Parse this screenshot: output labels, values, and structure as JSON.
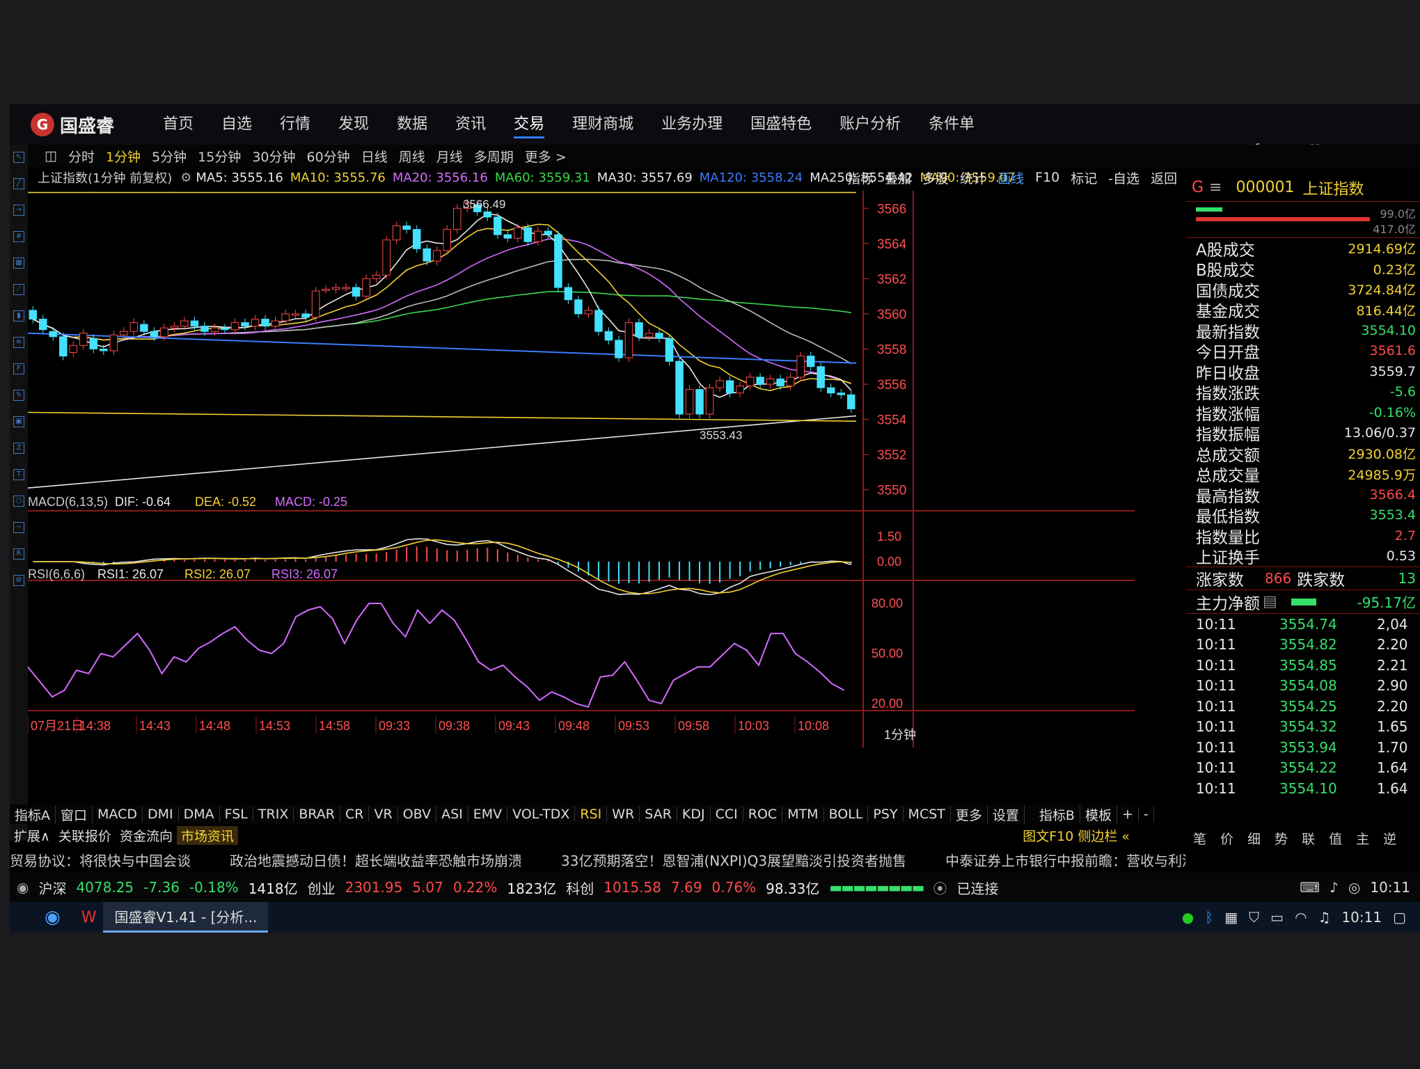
{
  "app": {
    "logo": "国盛睿",
    "nav": [
      "首页",
      "自选",
      "行情",
      "发现",
      "数据",
      "资讯",
      "交易",
      "理财商城",
      "业务办理",
      "国盛特色",
      "账户分析",
      "条件单"
    ],
    "active_nav": "交易"
  },
  "periods": [
    "分时",
    "1分钟",
    "5分钟",
    "15分钟",
    "30分钟",
    "60分钟",
    "日线",
    "周线",
    "月线",
    "多周期",
    "更多 >"
  ],
  "active_period": "1分钟",
  "main_header": {
    "title": "上证指数(1分钟 前复权)",
    "ma": [
      {
        "label": "MA5: 3555.16",
        "color": "#e8e8e8"
      },
      {
        "label": "MA10: 3555.76",
        "color": "#f2d133"
      },
      {
        "label": "MA20: 3556.16",
        "color": "#d36bff"
      },
      {
        "label": "MA60: 3559.31",
        "color": "#39d94a"
      },
      {
        "label": "MA30: 3557.69",
        "color": "#e8e8e8"
      },
      {
        "label": "MA120: 3558.24",
        "color": "#3a7dff"
      },
      {
        "label": "MA250: 3554.42",
        "color": "#e8e8e8"
      },
      {
        "label": "MA90: 3559.07",
        "color": "#f2d133"
      }
    ]
  },
  "tools": [
    "指标",
    "叠加",
    "多股",
    "统计",
    "画线",
    "F10",
    "标记",
    "-自选",
    "返回"
  ],
  "chart_data": {
    "type": "candlestick",
    "price_axis": {
      "ticks": [
        "3566",
        "3564",
        "3562",
        "3560",
        "3558",
        "3556",
        "3554",
        "3552",
        "3550"
      ],
      "range": [
        3549,
        3567
      ]
    },
    "high_label": "3566.49",
    "low_label": "3553.43",
    "candles": [
      [
        3560.2,
        3559.7
      ],
      [
        3559.7,
        3559.1
      ],
      [
        3559.0,
        3558.7
      ],
      [
        3558.7,
        3557.6
      ],
      [
        3557.8,
        3558.2
      ],
      [
        3558.2,
        3558.9
      ],
      [
        3558.6,
        3558.0
      ],
      [
        3558.0,
        3557.9
      ],
      [
        3557.9,
        3558.8
      ],
      [
        3558.8,
        3559.0
      ],
      [
        3559.0,
        3559.5
      ],
      [
        3559.4,
        3559.0
      ],
      [
        3559.0,
        3558.7
      ],
      [
        3558.7,
        3559.2
      ],
      [
        3559.2,
        3559.3
      ],
      [
        3559.3,
        3559.6
      ],
      [
        3559.6,
        3559.3
      ],
      [
        3559.3,
        3559.0
      ],
      [
        3559.0,
        3559.2
      ],
      [
        3559.2,
        3559.1
      ],
      [
        3559.1,
        3559.5
      ],
      [
        3559.5,
        3559.3
      ],
      [
        3559.3,
        3559.7
      ],
      [
        3559.7,
        3559.3
      ],
      [
        3559.3,
        3559.6
      ],
      [
        3559.6,
        3560.0
      ],
      [
        3560.0,
        3560.0
      ],
      [
        3560.0,
        3559.8
      ],
      [
        3559.8,
        3561.3
      ],
      [
        3561.4,
        3561.4
      ],
      [
        3561.4,
        3561.5
      ],
      [
        3561.5,
        3561.5
      ],
      [
        3561.5,
        3561.0
      ],
      [
        3561.0,
        3562.0
      ],
      [
        3562.0,
        3562.2
      ],
      [
        3562.2,
        3564.2
      ],
      [
        3564.2,
        3565.0
      ],
      [
        3565.0,
        3564.8
      ],
      [
        3564.8,
        3563.7
      ],
      [
        3563.7,
        3563.0
      ],
      [
        3563.0,
        3563.6
      ],
      [
        3563.6,
        3564.8
      ],
      [
        3564.8,
        3566.0
      ],
      [
        3566.0,
        3566.3
      ],
      [
        3566.2,
        3565.8
      ],
      [
        3565.8,
        3565.5
      ],
      [
        3565.5,
        3564.5
      ],
      [
        3564.5,
        3564.3
      ],
      [
        3564.3,
        3564.9
      ],
      [
        3564.9,
        3564.1
      ],
      [
        3564.1,
        3564.7
      ],
      [
        3564.7,
        3564.5
      ],
      [
        3564.5,
        3561.5
      ],
      [
        3561.5,
        3560.8
      ],
      [
        3560.8,
        3560.0
      ],
      [
        3560.0,
        3560.2
      ],
      [
        3560.2,
        3559.0
      ],
      [
        3559.0,
        3558.5
      ],
      [
        3558.5,
        3557.5
      ],
      [
        3557.5,
        3559.5
      ],
      [
        3559.5,
        3558.7
      ],
      [
        3558.7,
        3558.9
      ],
      [
        3558.9,
        3558.6
      ],
      [
        3558.6,
        3557.3
      ],
      [
        3557.3,
        3554.3
      ],
      [
        3554.3,
        3555.7
      ],
      [
        3555.7,
        3554.3
      ],
      [
        3554.3,
        3555.8
      ],
      [
        3555.8,
        3556.2
      ],
      [
        3556.2,
        3555.5
      ],
      [
        3555.5,
        3555.9
      ],
      [
        3555.9,
        3556.4
      ],
      [
        3556.4,
        3556.0
      ],
      [
        3556.0,
        3556.3
      ],
      [
        3556.3,
        3555.9
      ],
      [
        3555.9,
        3556.4
      ],
      [
        3556.4,
        3557.6
      ],
      [
        3557.6,
        3557.0
      ],
      [
        3557.0,
        3555.8
      ],
      [
        3555.8,
        3555.5
      ],
      [
        3555.5,
        3555.4
      ],
      [
        3555.4,
        3554.6
      ]
    ],
    "macd_header": {
      "label": "MACD(6,13,5)",
      "dif": "DIF: -0.64",
      "dea": "DEA: -0.52",
      "macd": "MACD: -0.25"
    },
    "macd_axis": [
      "1.50",
      "0.00"
    ],
    "rsi_header": {
      "label": "RSI(6,6,6)",
      "rsi1": "RSI1: 26.07",
      "rsi2": "RSI2: 26.07",
      "rsi3": "RSI3: 26.07"
    },
    "rsi_axis": [
      "80.00",
      "50.00",
      "20.00"
    ],
    "rsi_values": [
      42,
      33,
      24,
      28,
      40,
      38,
      50,
      48,
      55,
      62,
      52,
      38,
      48,
      45,
      53,
      57,
      62,
      66,
      58,
      52,
      50,
      56,
      72,
      76,
      78,
      71,
      56,
      70,
      80,
      80,
      68,
      60,
      76,
      68,
      76,
      70,
      58,
      45,
      40,
      43,
      36,
      30,
      22,
      27,
      24,
      20,
      18,
      36,
      37,
      45,
      34,
      22,
      20,
      34,
      38,
      42,
      42,
      49,
      56,
      52,
      43,
      62,
      62,
      50,
      45,
      39,
      32,
      28
    ],
    "time_labels": [
      "07月21日",
      "14:38",
      "14:43",
      "14:48",
      "14:53",
      "14:58",
      "09:33",
      "09:38",
      "09:43",
      "09:48",
      "09:53",
      "09:58",
      "10:03",
      "10:08"
    ],
    "period_tag": "1分钟"
  },
  "indicator_tabs": [
    "指标A",
    "窗口",
    "MACD",
    "DMI",
    "DMA",
    "FSL",
    "TRIX",
    "BRAR",
    "CR",
    "VR",
    "OBV",
    "ASI",
    "EMV",
    "VOL-TDX",
    "RSI",
    "WR",
    "SAR",
    "KDJ",
    "CCI",
    "ROC",
    "MTM",
    "BOLL",
    "PSY",
    "MCST",
    "更多",
    "设置"
  ],
  "indicator_active": "RSI",
  "indicator_tabs_right": [
    "指标B",
    "模板",
    "+",
    "-"
  ],
  "sub_tabs": [
    "扩展∧",
    "关联报价",
    "资金流向",
    "市场资讯"
  ],
  "sub_tabs_right": "图文F10 侧边栏 «",
  "right_panel": {
    "code": "000001",
    "name": "上证指数",
    "top_nums": [
      "99.0亿",
      "417.0亿"
    ],
    "stats": [
      {
        "label": "A股成交",
        "value": "2914.69亿",
        "color": "#f2d133"
      },
      {
        "label": "B股成交",
        "value": "0.23亿",
        "color": "#f2d133"
      },
      {
        "label": "国债成交",
        "value": "3724.84亿",
        "color": "#f2d133"
      },
      {
        "label": "基金成交",
        "value": "816.44亿",
        "color": "#f2d133"
      },
      {
        "label": "最新指数",
        "value": "3554.10",
        "color": "#35e06a"
      },
      {
        "label": "今日开盘",
        "value": "3561.6",
        "color": "#ff4a4a"
      },
      {
        "label": "昨日收盘",
        "value": "3559.7",
        "color": "#e8e8e8"
      },
      {
        "label": "指数涨跌",
        "value": "-5.6",
        "color": "#35e06a"
      },
      {
        "label": "指数涨幅",
        "value": "-0.16%",
        "color": "#35e06a"
      },
      {
        "label": "指数振幅",
        "value": "13.06/0.37",
        "color": "#e8e8e8"
      },
      {
        "label": "总成交额",
        "value": "2930.08亿",
        "color": "#f2d133"
      },
      {
        "label": "总成交量",
        "value": "24985.9万",
        "color": "#f2d133"
      },
      {
        "label": "最高指数",
        "value": "3566.4",
        "color": "#ff4a4a"
      },
      {
        "label": "最低指数",
        "value": "3553.4",
        "color": "#35e06a"
      },
      {
        "label": "指数量比",
        "value": "2.7",
        "color": "#ff4a4a"
      },
      {
        "label": "上证换手",
        "value": "0.53",
        "color": "#e8e8e8"
      }
    ],
    "zhangjia": {
      "label": "涨家数",
      "up": "866",
      "down_label": "跌家数",
      "down": "13"
    },
    "zhuli": {
      "label": "主力净额",
      "value": "-95.17亿"
    },
    "ticks": [
      {
        "t": "10:11",
        "p": "3554.74",
        "q": "2,04"
      },
      {
        "t": "10:11",
        "p": "3554.82",
        "q": "2.20"
      },
      {
        "t": "10:11",
        "p": "3554.85",
        "q": "2.21"
      },
      {
        "t": "10:11",
        "p": "3554.08",
        "q": "2.90"
      },
      {
        "t": "10:11",
        "p": "3554.25",
        "q": "2.20"
      },
      {
        "t": "10:11",
        "p": "3554.32",
        "q": "1.65"
      },
      {
        "t": "10:11",
        "p": "3553.94",
        "q": "1.70"
      },
      {
        "t": "10:11",
        "p": "3554.22",
        "q": "1.64"
      },
      {
        "t": "10:11",
        "p": "3554.10",
        "q": "1.64"
      }
    ],
    "footer": [
      "笔",
      "价",
      "细",
      "势",
      "联",
      "值",
      "主",
      "逆"
    ]
  },
  "ticker": [
    "贸易协议：将很快与中国会谈",
    "政治地震撼动日债！超长端收益率恐触市场崩溃",
    "33亿预期落空！恩智浦(NXPI)Q3展望黯淡引投资者抛售",
    "中泰证券上市银行中报前瞻：营收与利润增速环比小幅向上 关注两条"
  ],
  "status": {
    "hs": "沪深",
    "hs_val": "4078.25",
    "hs_chg": "-7.36",
    "hs_pct": "-0.18%",
    "hs_amt": "1418亿",
    "cy": "创业",
    "cy_val": "2301.95",
    "cy_chg": "5.07",
    "cy_pct": "0.22%",
    "cy_amt": "1823亿",
    "kc": "科创",
    "kc_val": "1015.58",
    "kc_chg": "7.69",
    "kc_pct": "0.76%",
    "kc_amt": "98.33亿",
    "conn": "已连接",
    "time": "10:11"
  },
  "taskbar": {
    "app": "国盛睿V1.41 - [分析...",
    "time": "10:11"
  }
}
